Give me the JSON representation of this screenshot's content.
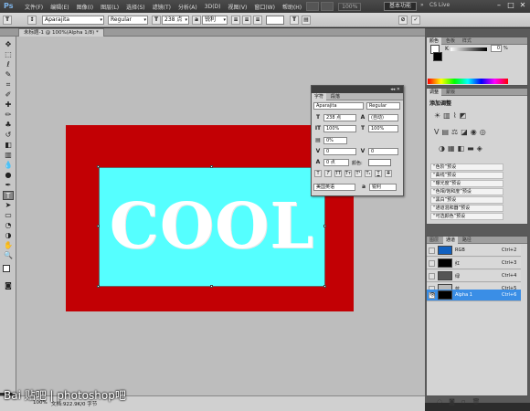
{
  "app": {
    "logo": "Ps",
    "menus": [
      "文件(F)",
      "编辑(E)",
      "图像(I)",
      "图层(L)",
      "选择(S)",
      "滤镜(T)",
      "分析(A)",
      "3D(D)",
      "视图(V)",
      "窗口(W)",
      "帮助(H)"
    ],
    "zoom": "100%",
    "workspace_button": "基本功能",
    "workspace_more": "»",
    "cs_live": "CS Live",
    "window_controls": [
      "–",
      "□",
      "✕"
    ]
  },
  "options_bar": {
    "font_family": "Aparajita",
    "font_style": "Regular",
    "font_size": "238 点",
    "antialias": "锐利",
    "text_color": "#ffffff"
  },
  "document": {
    "tab_label": "未标题-1 @ 100%(Alpha 1/8) *",
    "text_content": "COOL",
    "bg_color": "#c20004",
    "text_box_color": "#55ffff"
  },
  "character_panel": {
    "header": "◂◂  ✕",
    "tabs": [
      "字符",
      "段落"
    ],
    "font_family": "Aparajita",
    "font_style": "Regular",
    "size": "238 点",
    "leading": "(自动)",
    "vertical_scale": "100%",
    "horizontal_scale": "100%",
    "tsume": "0%",
    "kerning": "0",
    "tracking": "0",
    "baseline": "0 点",
    "color_label": "颜色:",
    "language": "美国英语",
    "antialias": "锐利",
    "format_buttons": [
      "T",
      "T",
      "TT",
      "Tт",
      "T¹",
      "T₁",
      "T",
      "T"
    ]
  },
  "color_panel": {
    "tabs": [
      "颜色",
      "色板",
      "样式"
    ],
    "channel_label": "K",
    "channel_value": "0",
    "percent": "%"
  },
  "adjust_panel": {
    "tabs": [
      "调整",
      "蒙版"
    ],
    "title": "添加调整",
    "presets": [
      "“色阶”预设",
      "“曲线”预设",
      "“曝光度”预设",
      "“色相/饱和度”预设",
      "“黑白”预设",
      "“通道混和器”预设",
      "“可选颜色”预设"
    ]
  },
  "channels_panel": {
    "tabs": [
      "图层",
      "通道",
      "路径"
    ],
    "rows": [
      {
        "name": "RGB",
        "key": "Ctrl+2",
        "thumb": "#1060c0"
      },
      {
        "name": "红",
        "key": "Ctrl+3",
        "thumb": "#000000"
      },
      {
        "name": "绿",
        "key": "Ctrl+4",
        "thumb": "#555555"
      },
      {
        "name": "蓝",
        "key": "Ctrl+5",
        "thumb": "#bbbbbb"
      },
      {
        "name": "Alpha 1",
        "key": "Ctrl+6",
        "thumb": "#000000"
      }
    ]
  },
  "status_bar": {
    "zoom": "100%",
    "doc_info": "文档:922.9K/0 字节"
  },
  "watermark": "Bai 贴吧 | photoshop吧"
}
